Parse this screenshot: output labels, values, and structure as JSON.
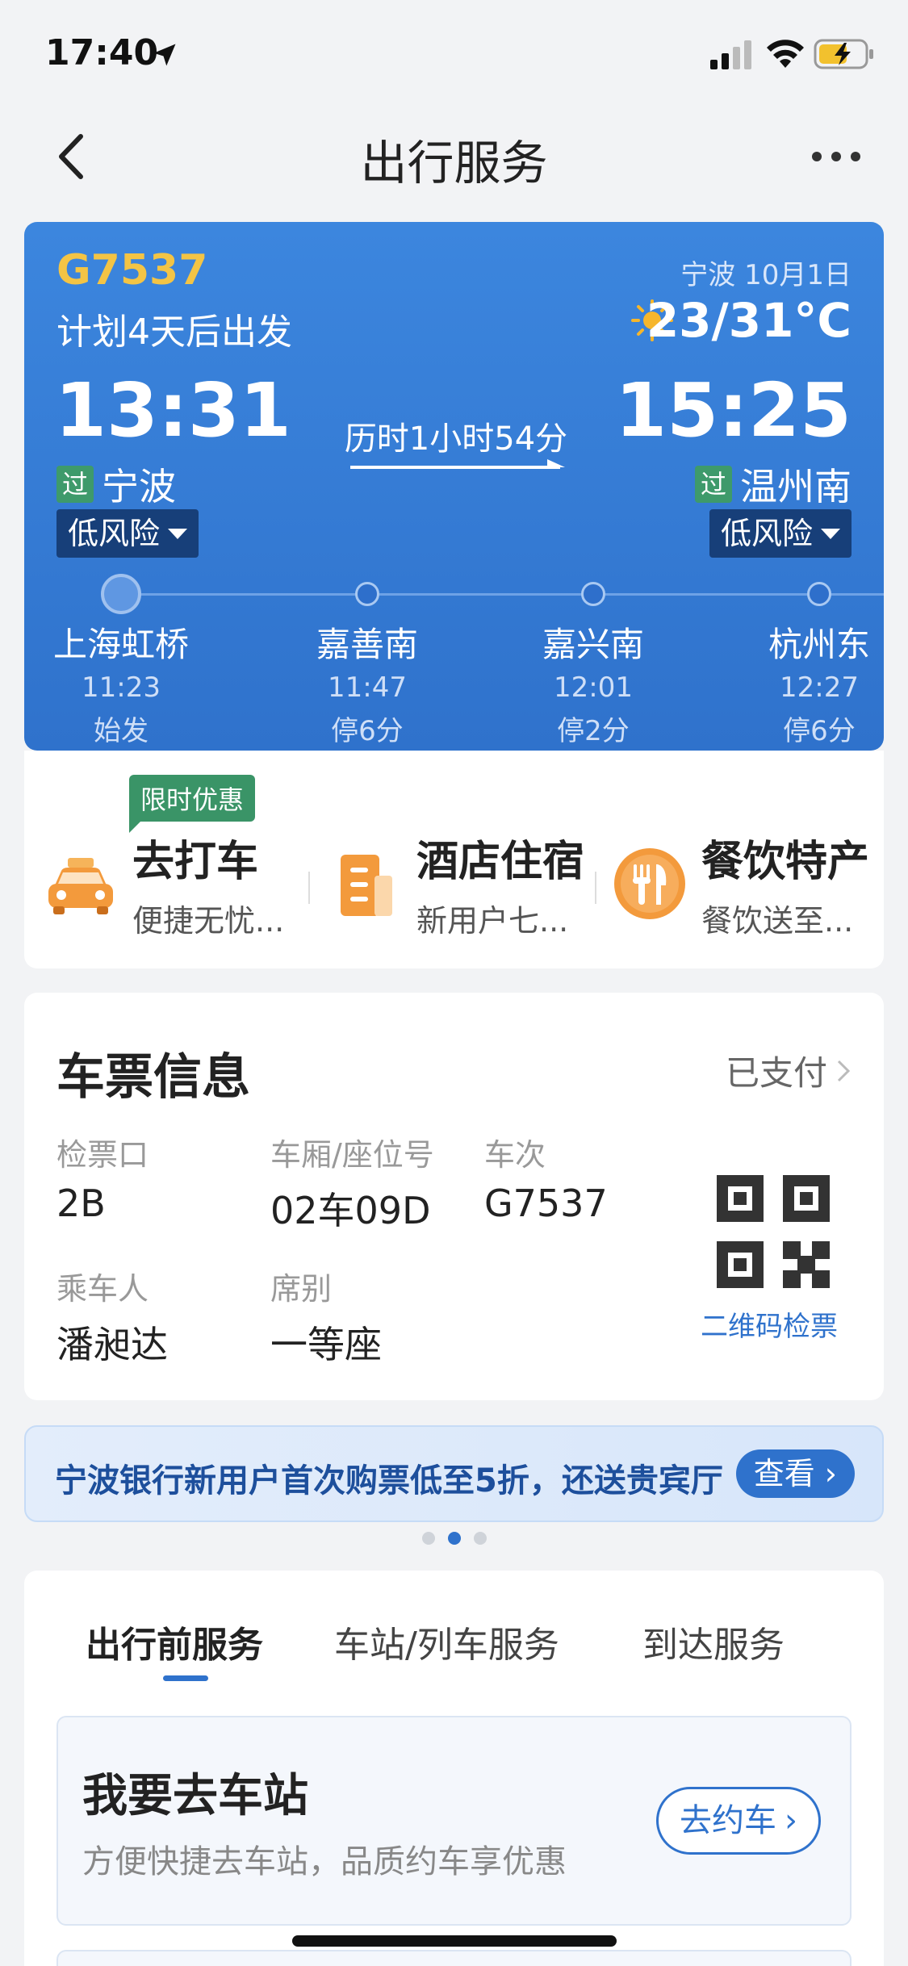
{
  "status_bar": {
    "time": "17:40"
  },
  "nav": {
    "title": "出行服务"
  },
  "trip": {
    "train_no": "G7537",
    "plan": "计划4天后出发",
    "weather_place": "宁波 10月1日",
    "weather_temp": "23/31°C",
    "dep_time": "13:31",
    "arr_time": "15:25",
    "duration": "历时1小时54分",
    "pass_tag": "过",
    "dep_station": "宁波",
    "arr_station": "温州南",
    "dep_risk": "低风险",
    "arr_risk": "低风险",
    "stops": [
      {
        "name": "上海虹桥",
        "time": "11:23",
        "stay": "始发"
      },
      {
        "name": "嘉善南",
        "time": "11:47",
        "stay": "停6分"
      },
      {
        "name": "嘉兴南",
        "time": "12:01",
        "stay": "停2分"
      },
      {
        "name": "杭州东",
        "time": "12:27",
        "stay": "停6分"
      }
    ]
  },
  "services": {
    "promo_tag": "限时优惠",
    "items": [
      {
        "title": "去打车",
        "sub": "便捷无忧...",
        "icon": "taxi-icon",
        "color": "#f39a3c"
      },
      {
        "title": "酒店住宿",
        "sub": "新用户七...",
        "icon": "hotel-icon",
        "color": "#f39a3c"
      },
      {
        "title": "餐饮特产",
        "sub": "餐饮送至...",
        "icon": "dining-icon",
        "color": "#f39a3c"
      }
    ]
  },
  "ticket": {
    "title": "车票信息",
    "status": "已支付",
    "gate_label": "检票口",
    "gate_value": "2B",
    "seat_label": "车厢/座位号",
    "seat_value": "02车09D",
    "train_label": "车次",
    "train_value": "G7537",
    "passenger_label": "乘车人",
    "passenger_value": "潘昶达",
    "class_label": "席别",
    "class_value": "一等座",
    "qr_label": "二维码检票"
  },
  "banner": {
    "text": "宁波银行新用户首次购票低至5折，还送贵宾厅",
    "button": "查看"
  },
  "tabs": [
    "出行前服务",
    "车站/列车服务",
    "到达服务"
  ],
  "station_box": {
    "title": "我要去车站",
    "sub": "方便快捷去车站，品质约车享优惠",
    "button": "去约车"
  },
  "colors": {
    "brand_blue": "#2f72cc",
    "accent_yellow": "#f3c445",
    "pass_green": "#3e9a6b"
  }
}
